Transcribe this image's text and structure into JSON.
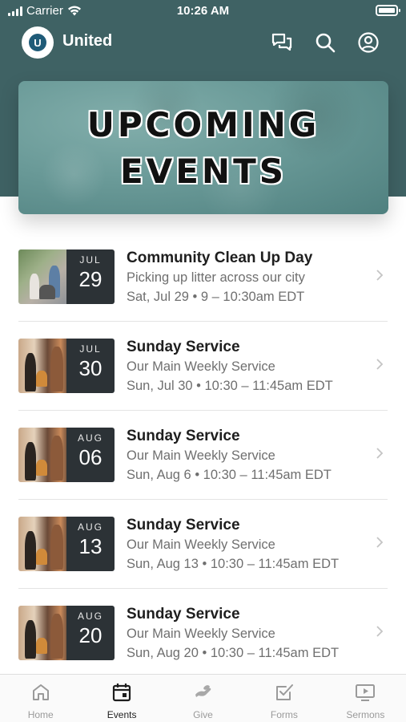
{
  "status_bar": {
    "carrier": "Carrier",
    "time": "10:26 AM"
  },
  "app": {
    "title": "United",
    "logo_letter": "U"
  },
  "banner": {
    "line1": "UPCOMING",
    "line2": "EVENTS"
  },
  "header_icons": [
    "messages-icon",
    "search-icon",
    "profile-icon"
  ],
  "events": [
    {
      "title": "Community Clean Up Day",
      "subtitle": "Picking up litter across our city",
      "time": "Sat, Jul 29 • 9 – 10:30am EDT",
      "month": "JUL",
      "day": "29",
      "image": "community-cleanup-photo"
    },
    {
      "title": "Sunday Service",
      "subtitle": "Our Main Weekly Service",
      "time": "Sun, Jul 30 • 10:30 – 11:45am EDT",
      "month": "JUL",
      "day": "30",
      "image": "worship-band-photo"
    },
    {
      "title": "Sunday Service",
      "subtitle": "Our Main Weekly Service",
      "time": "Sun, Aug 6 • 10:30 – 11:45am EDT",
      "month": "AUG",
      "day": "06",
      "image": "worship-band-photo"
    },
    {
      "title": "Sunday Service",
      "subtitle": "Our Main Weekly Service",
      "time": "Sun, Aug 13 • 10:30 – 11:45am EDT",
      "month": "AUG",
      "day": "13",
      "image": "worship-band-photo"
    },
    {
      "title": "Sunday Service",
      "subtitle": "Our Main Weekly Service",
      "time": "Sun, Aug 20 • 10:30 – 11:45am EDT",
      "month": "AUG",
      "day": "20",
      "image": "worship-band-photo"
    }
  ],
  "tabs": [
    {
      "label": "Home",
      "icon": "home-icon",
      "active": false
    },
    {
      "label": "Events",
      "icon": "calendar-icon",
      "active": true
    },
    {
      "label": "Give",
      "icon": "give-hand-icon",
      "active": false
    },
    {
      "label": "Forms",
      "icon": "checkbox-form-icon",
      "active": false
    },
    {
      "label": "Sermons",
      "icon": "video-play-icon",
      "active": false
    }
  ],
  "colors": {
    "header": "#3f6264",
    "date_box": "#2c3236",
    "tab_active": "#1e1e1e",
    "tab_inactive": "#9a9a9a"
  }
}
